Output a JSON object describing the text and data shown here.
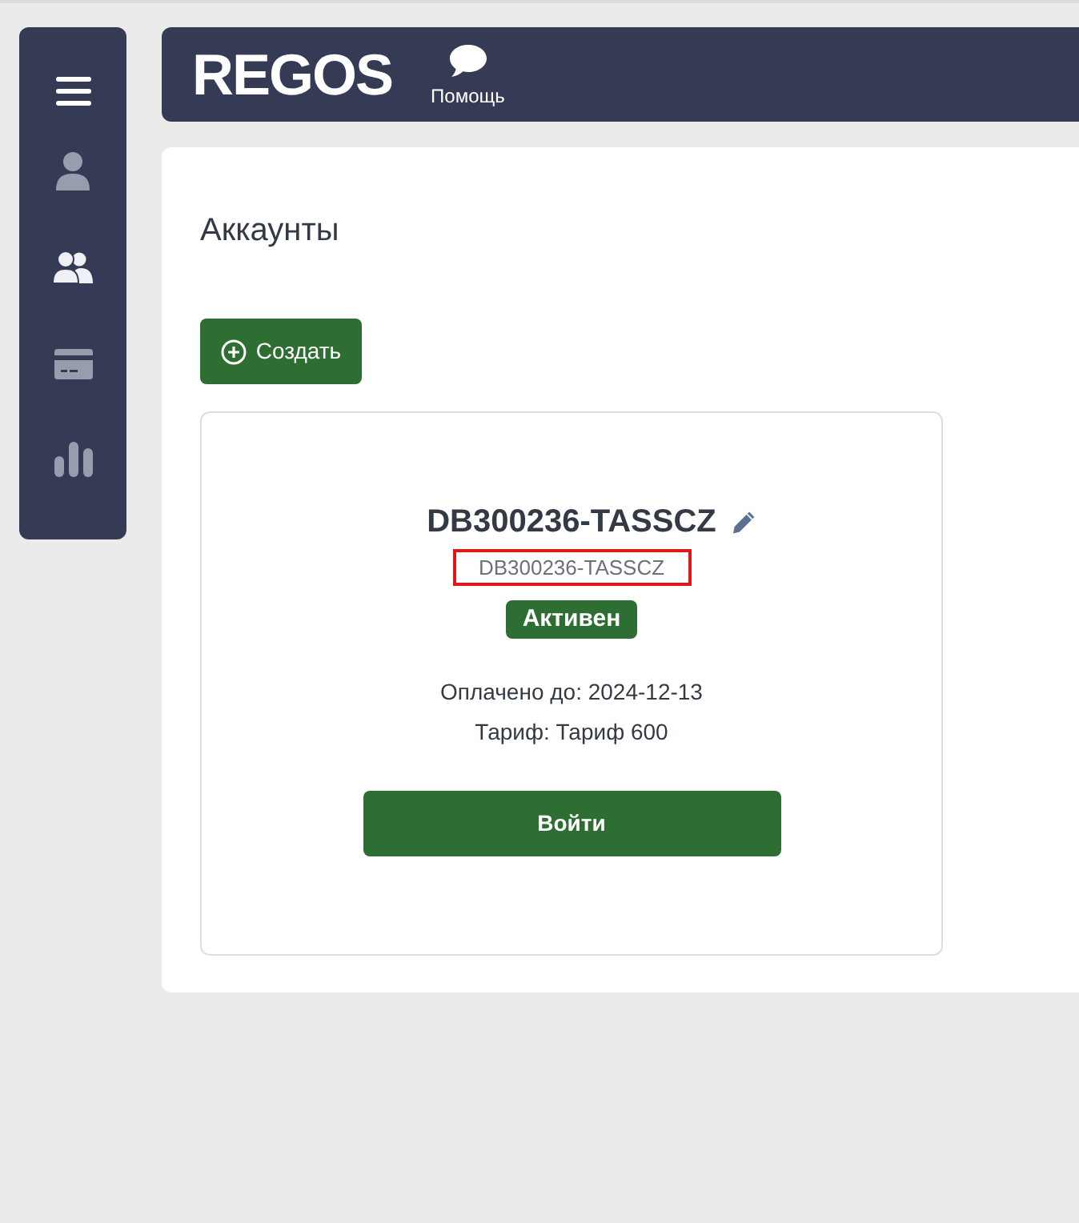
{
  "sidebar": {
    "items": [
      {
        "selected": false
      },
      {
        "selected": true
      },
      {
        "selected": false
      },
      {
        "selected": false
      }
    ]
  },
  "topbar": {
    "logo": "REGOS",
    "help": {
      "label": "Помощь"
    }
  },
  "page": {
    "title": "Аккаунты",
    "create_button": "Создать"
  },
  "accounts": [
    {
      "name": "DB300236-TASSCZ",
      "code": "DB300236-TASSCZ",
      "code_highlighted": true,
      "status": "Активен",
      "paid_until": "Оплачено до: 2024-12-13",
      "tariff": "Тариф: Тариф 600",
      "login_button": "Войти"
    }
  ]
}
